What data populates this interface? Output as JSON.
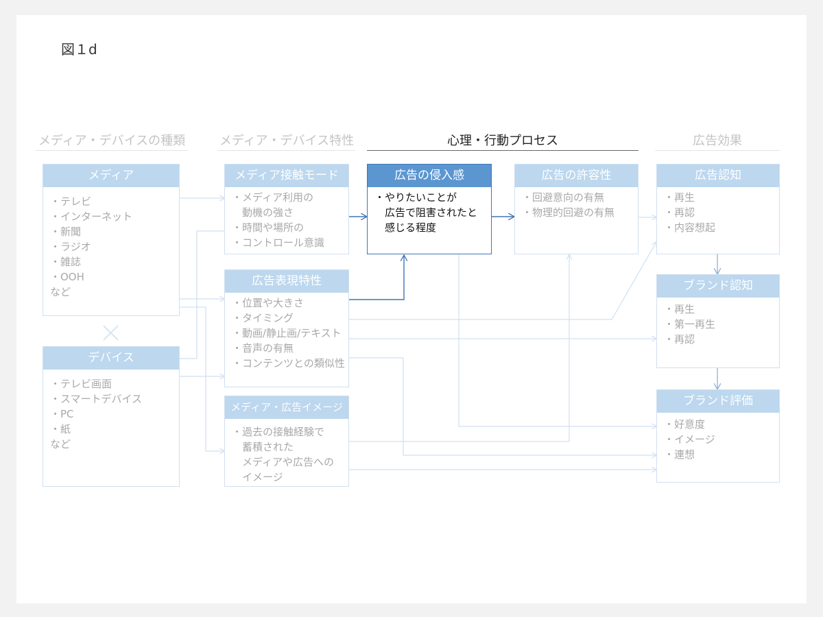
{
  "figure_title": "図１d",
  "columns": {
    "media_types": "メディア・デバイスの種類",
    "media_traits": "メディア・デバイス特性",
    "process": "心理・行動プロセス",
    "effects": "広告効果"
  },
  "boxes": {
    "media": {
      "title": "メディア",
      "items": [
        "・テレビ",
        "・インターネット",
        "・新聞",
        "・ラジオ",
        "・雑誌",
        "・OOH",
        "など"
      ]
    },
    "device": {
      "title": "デバイス",
      "items": [
        "・テレビ画面",
        "・スマートデバイス",
        "・PC",
        "・紙",
        "など"
      ]
    },
    "contact_mode": {
      "title": "メディア接触モード",
      "items": [
        "・メディア利用の",
        "　動機の強さ",
        "・時間や場所の",
        "・コントロール意識"
      ]
    },
    "ad_expression": {
      "title": "広告表現特性",
      "items": [
        "・位置や大きさ",
        "・タイミング",
        "・動画/静止画/テキスト",
        "・音声の有無",
        "・コンテンツとの類似性"
      ]
    },
    "media_image": {
      "title": "メディア・広告イメージ",
      "items": [
        "・過去の接触経験で",
        "　蓄積された",
        "　メディアや広告への",
        "　イメージ"
      ]
    },
    "intrusiveness": {
      "title": "広告の侵入感",
      "items": [
        "・やりたいことが",
        "　広告で阻害されたと",
        "　感じる程度"
      ]
    },
    "tolerance": {
      "title": "広告の許容性",
      "items": [
        "・回避意向の有無",
        "・物理的回避の有無"
      ]
    },
    "ad_awareness": {
      "title": "広告認知",
      "items": [
        "・再生",
        "・再認",
        "・内容想起"
      ]
    },
    "brand_awareness": {
      "title": "ブランド認知",
      "items": [
        "・再生",
        "・第一再生",
        "・再認"
      ]
    },
    "brand_evaluation": {
      "title": "ブランド評価",
      "items": [
        "・好意度",
        "・イメージ",
        "・連想"
      ]
    }
  },
  "colors": {
    "header_light": "#bcd7ee",
    "header_active": "#5b96d1",
    "line_light": "#cfe0f0",
    "line_active": "#3f75b5",
    "text_muted": "#a8a8a8"
  }
}
